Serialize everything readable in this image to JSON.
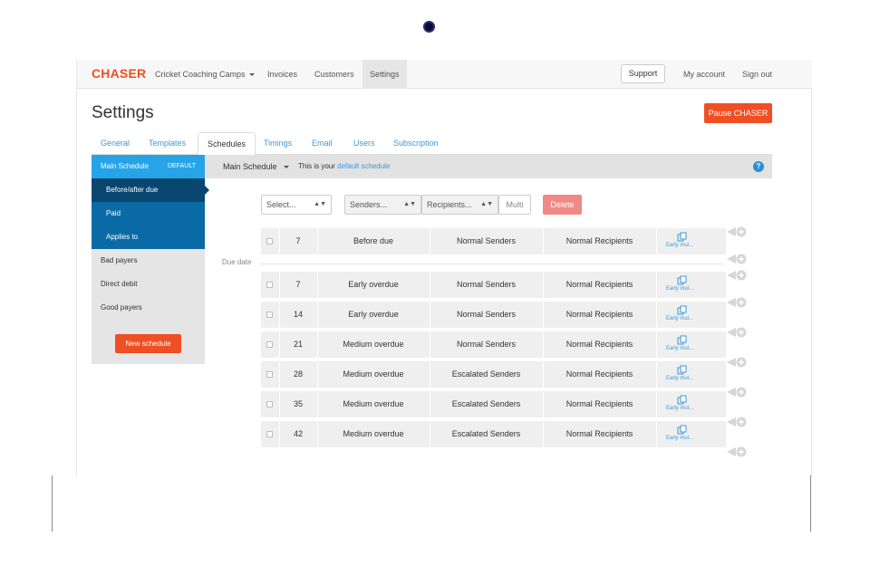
{
  "brand": "CHASER",
  "nav": {
    "org_label": "Cricket Coaching Camps",
    "items": [
      "Invoices",
      "Customers",
      "Settings"
    ],
    "support_label": "Support",
    "my_account_label": "My account",
    "sign_out_label": "Sign out"
  },
  "page": {
    "title": "Settings",
    "pause_label": "Pause CHASER"
  },
  "tabs": [
    "General",
    "Templates",
    "Schedules",
    "Timings",
    "Email",
    "Users",
    "Subscription"
  ],
  "sidebar": {
    "main_label": "Main Schedule",
    "default_badge": "DEFAULT",
    "subitems": [
      "Before/after due",
      "Paid",
      "Applies to"
    ],
    "items": [
      "Bad payers",
      "Direct debit",
      "Good payers"
    ],
    "new_label": "New schedule"
  },
  "schedule_bar": {
    "name": "Main Schedule",
    "desc_prefix": "This is your",
    "desc_link": "default schedule"
  },
  "filters": {
    "select_placeholder": "Select...",
    "senders_placeholder": "Senders...",
    "recipients_placeholder": "Recipients...",
    "multi_label": "Multi",
    "delete_label": "Delete"
  },
  "due_date_label": "Due date",
  "copy_label": "Early mul...",
  "rows": [
    {
      "days": "7",
      "template": "Before due",
      "senders": "Normal Senders",
      "recipients": "Normal Recipients"
    },
    {
      "days": "7",
      "template": "Early overdue",
      "senders": "Normal Senders",
      "recipients": "Normal Recipients"
    },
    {
      "days": "14",
      "template": "Early overdue",
      "senders": "Normal Senders",
      "recipients": "Normal Recipients"
    },
    {
      "days": "21",
      "template": "Medium overdue",
      "senders": "Normal Senders",
      "recipients": "Normal Recipients"
    },
    {
      "days": "28",
      "template": "Medium overdue",
      "senders": "Escalated Senders",
      "recipients": "Normal Recipients"
    },
    {
      "days": "35",
      "template": "Medium overdue",
      "senders": "Escalated Senders",
      "recipients": "Normal Recipients"
    },
    {
      "days": "42",
      "template": "Medium overdue",
      "senders": "Escalated Senders",
      "recipients": "Normal Recipients"
    }
  ],
  "colors": {
    "brand": "#f04e23",
    "primary": "#27a4e8",
    "dark_blue": "#0a6aa5",
    "link": "#3a9ad9"
  },
  "icons": [
    "copy-icon",
    "add-step-icon",
    "help-icon",
    "caret-down-icon"
  ]
}
